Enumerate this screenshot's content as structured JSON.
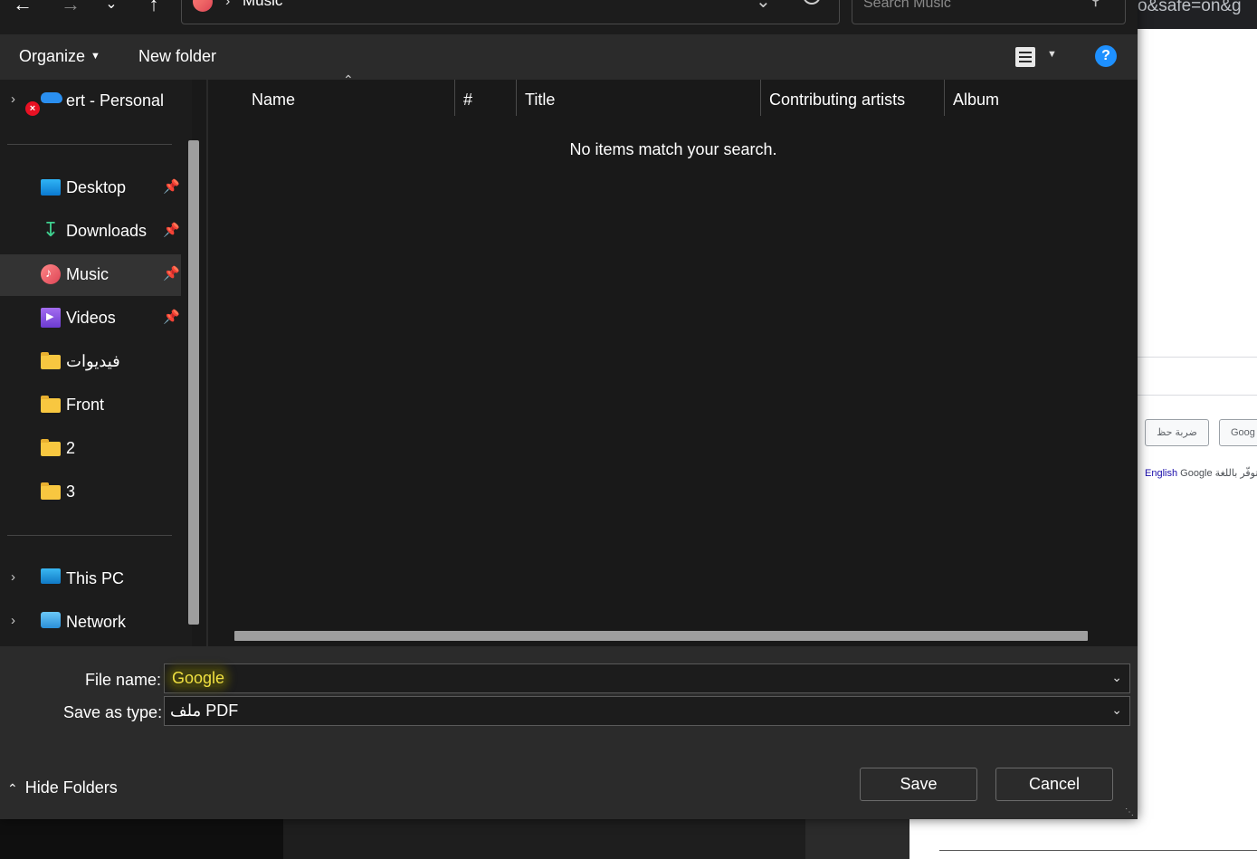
{
  "background": {
    "url_fragment": "o&safe=on&g",
    "page_button_1": "ضربة حظ",
    "page_button_2": "Goog",
    "lang_text": "Google متوفّر باللغة:",
    "lang_link": "English"
  },
  "address_bar": {
    "breadcrumb": "Music",
    "search_placeholder": "Search Music"
  },
  "toolbar": {
    "organize": "Organize",
    "new_folder": "New folder",
    "help": "?"
  },
  "nav": {
    "onedrive": "ert - Personal",
    "items": [
      {
        "label": "Desktop",
        "icon": "desktop-icon",
        "pinned": true
      },
      {
        "label": "Downloads",
        "icon": "download-icon",
        "pinned": true
      },
      {
        "label": "Music",
        "icon": "music-icon",
        "pinned": true,
        "selected": true
      },
      {
        "label": "Videos",
        "icon": "videos-icon",
        "pinned": true
      },
      {
        "label": "فيديوات",
        "icon": "folder-icon",
        "pinned": false
      },
      {
        "label": "Front",
        "icon": "folder-icon",
        "pinned": false
      },
      {
        "label": "2",
        "icon": "folder-icon",
        "pinned": false
      },
      {
        "label": "3",
        "icon": "folder-icon",
        "pinned": false
      }
    ],
    "this_pc": "This PC",
    "network": "Network"
  },
  "columns": {
    "name": "Name",
    "number": "#",
    "title": "Title",
    "contributing_artists": "Contributing artists",
    "album": "Album"
  },
  "empty_message": "No items match your search.",
  "bottom": {
    "file_name_label": "File name:",
    "file_name_value": "Google",
    "save_as_type_label": "Save as type:",
    "save_as_type_value": "ملف PDF",
    "hide_folders": "Hide Folders",
    "save": "Save",
    "cancel": "Cancel"
  }
}
